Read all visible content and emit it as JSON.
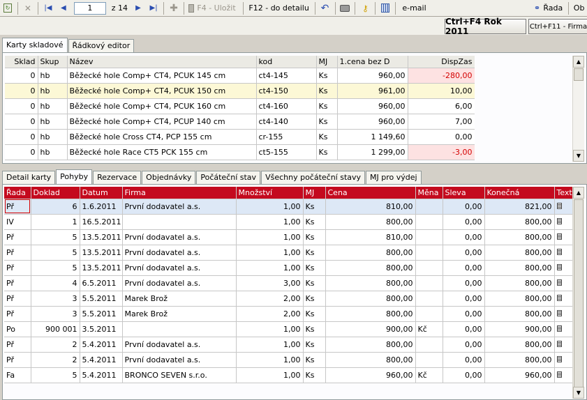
{
  "toolbar": {
    "page_value": "1",
    "page_total": "z 14",
    "save_label": "F4 - Uložit",
    "detail_label": "F12 - do detailu",
    "email_label": "e-mail",
    "rada_label": "Řada",
    "ob_label": "Ob"
  },
  "cmd": {
    "year_label": "Ctrl+F4 Rok 2011",
    "firma_label": "Ctrl+F11 - Firma"
  },
  "upper_tabs": [
    "Karty skladové",
    "Řádkový editor"
  ],
  "upper_grid": {
    "headers": [
      "Sklad",
      "Skup",
      "Název",
      "kod",
      "MJ",
      "1.cena bez D",
      "DispZas"
    ],
    "rows": [
      [
        "0",
        "hb",
        "Běžecké hole Comp+ CT4, PCUK 145 cm",
        "ct4-145",
        "Ks",
        "960,00",
        "-280,00"
      ],
      [
        "0",
        "hb",
        "Běžecké hole Comp+ CT4, PCUK 150 cm",
        "ct4-150",
        "Ks",
        "961,00",
        "10,00"
      ],
      [
        "0",
        "hb",
        "Běžecké hole Comp+ CT4, PCUK 160 cm",
        "ct4-160",
        "Ks",
        "960,00",
        "6,00"
      ],
      [
        "0",
        "hb",
        "Běžecké hole Comp+ CT4, PCUP 140 cm",
        "ct4-140",
        "Ks",
        "960,00",
        "7,00"
      ],
      [
        "0",
        "hb",
        "Běžecké hole Cross CT4, PCP 155 cm",
        "cr-155",
        "Ks",
        "1 149,60",
        "0,00"
      ],
      [
        "0",
        "hb",
        "Běžecké hole Race CT5 PCK 155 cm",
        "ct5-155",
        "Ks",
        "1 299,00",
        "-3,00"
      ]
    ]
  },
  "lower_tabs": [
    "Detail karty",
    "Pohyby",
    "Rezervace",
    "Objednávky",
    "Počáteční stav",
    "Všechny počáteční stavy",
    "MJ pro výdej"
  ],
  "lower_grid": {
    "headers": [
      "Řada",
      "Doklad",
      "Datum",
      "Firma",
      "Množství",
      "MJ",
      "Cena",
      "Měna",
      "Sleva",
      "Konečná",
      "Text"
    ],
    "rows": [
      [
        "Př",
        "6",
        "1.6.2011",
        "První dodavatel a.s.",
        "1,00",
        "Ks",
        "810,00",
        "",
        "0,00",
        "821,00"
      ],
      [
        "IV",
        "1",
        "16.5.2011",
        "",
        "1,00",
        "Ks",
        "800,00",
        "",
        "0,00",
        "800,00"
      ],
      [
        "Př",
        "5",
        "13.5.2011",
        "První dodavatel a.s.",
        "1,00",
        "Ks",
        "810,00",
        "",
        "0,00",
        "800,00"
      ],
      [
        "Př",
        "5",
        "13.5.2011",
        "První dodavatel a.s.",
        "1,00",
        "Ks",
        "800,00",
        "",
        "0,00",
        "800,00"
      ],
      [
        "Př",
        "5",
        "13.5.2011",
        "První dodavatel a.s.",
        "1,00",
        "Ks",
        "800,00",
        "",
        "0,00",
        "800,00"
      ],
      [
        "Př",
        "4",
        "6.5.2011",
        "První dodavatel a.s.",
        "3,00",
        "Ks",
        "800,00",
        "",
        "0,00",
        "800,00"
      ],
      [
        "Př",
        "3",
        "5.5.2011",
        "Marek Brož",
        "2,00",
        "Ks",
        "800,00",
        "",
        "0,00",
        "800,00"
      ],
      [
        "Př",
        "3",
        "5.5.2011",
        "Marek Brož",
        "2,00",
        "Ks",
        "800,00",
        "",
        "0,00",
        "800,00"
      ],
      [
        "Po",
        "900 001",
        "3.5.2011",
        "",
        "1,00",
        "Ks",
        "900,00",
        "Kč",
        "0,00",
        "900,00"
      ],
      [
        "Př",
        "2",
        "5.4.2011",
        "První dodavatel a.s.",
        "1,00",
        "Ks",
        "800,00",
        "",
        "0,00",
        "800,00"
      ],
      [
        "Př",
        "2",
        "5.4.2011",
        "První dodavatel a.s.",
        "1,00",
        "Ks",
        "800,00",
        "",
        "0,00",
        "800,00"
      ],
      [
        "Fa",
        "5",
        "5.4.2011",
        "BRONCO SEVEN s.r.o.",
        "1,00",
        "Ks",
        "960,00",
        "Kč",
        "0,00",
        "960,00"
      ]
    ]
  },
  "colors": {
    "lower_header_bg": "#c40a1e",
    "selected_row": "#fcf8d6",
    "negative_text": "#d40000"
  }
}
